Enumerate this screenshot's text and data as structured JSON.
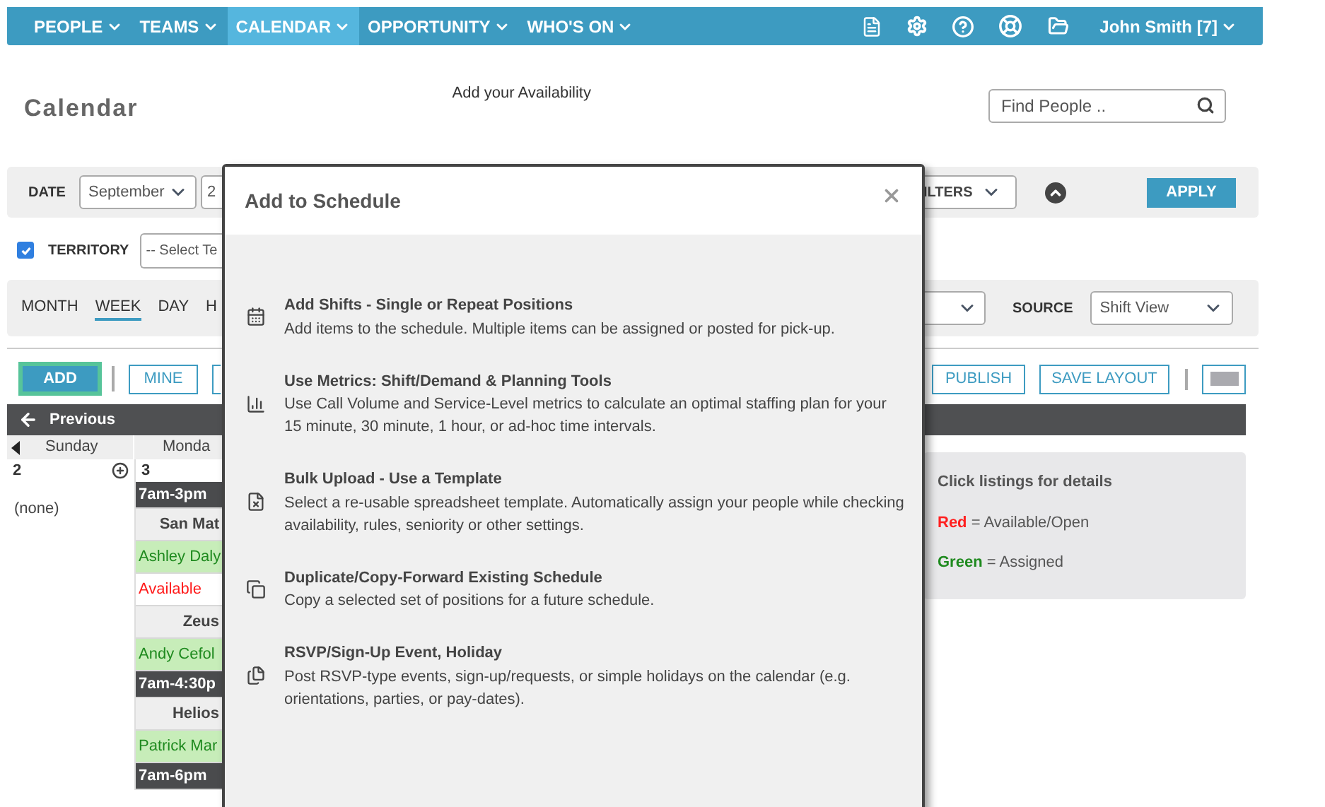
{
  "nav": {
    "items": [
      {
        "label": "PEOPLE",
        "selected": false
      },
      {
        "label": "TEAMS",
        "selected": false
      },
      {
        "label": "CALENDAR",
        "selected": true
      },
      {
        "label": "OPPORTUNITY",
        "selected": false
      },
      {
        "label": "WHO'S ON",
        "selected": false
      }
    ],
    "user": "John Smith [7]"
  },
  "page_title": "Calendar",
  "availability_link": "Add your Availability",
  "search": {
    "placeholder": "Find People .."
  },
  "filters": {
    "date_label": "DATE",
    "date_month": "September",
    "date_day": "2",
    "filters_select": "ILTERS",
    "apply": "APPLY"
  },
  "territory": {
    "checked": true,
    "label": "TERRITORY",
    "select": "-- Select Te"
  },
  "views": {
    "tabs": [
      {
        "label": "MONTH",
        "selected": false
      },
      {
        "label": "WEEK",
        "selected": true
      },
      {
        "label": "DAY",
        "selected": false
      },
      {
        "label": "H",
        "selected": false
      }
    ],
    "source_label": "SOURCE",
    "source_value": "Shift View"
  },
  "toolbar": {
    "add": "ADD",
    "mine": "MINE",
    "publish": "PUBLISH",
    "save_layout": "SAVE LAYOUT"
  },
  "calendar": {
    "previous": "Previous",
    "days": [
      {
        "name": "Sunday",
        "date": "2",
        "entries": [
          {
            "kind": "note",
            "text": "(none)"
          }
        ]
      },
      {
        "name": "Monda",
        "date": "3",
        "entries": [
          {
            "kind": "time",
            "text": "7am-3pm"
          },
          {
            "kind": "location",
            "text": "San Mat"
          },
          {
            "kind": "assigned",
            "text": "Ashley Daly"
          },
          {
            "kind": "open",
            "text": "Available"
          },
          {
            "kind": "location",
            "text": "Zeus"
          },
          {
            "kind": "assigned",
            "text": "Andy Cefol"
          },
          {
            "kind": "time",
            "text": "7am-4:30p"
          },
          {
            "kind": "location",
            "text": "Helios"
          },
          {
            "kind": "assigned",
            "text": "Patrick Mar"
          },
          {
            "kind": "time",
            "text": "7am-6pm"
          }
        ]
      }
    ]
  },
  "legend": {
    "title": "Click listings for details",
    "items": [
      {
        "label": "Red",
        "color": "#ff2020",
        "text": "= Available/Open"
      },
      {
        "label": "Green",
        "color": "#1f8a1f",
        "text": "= Assigned"
      }
    ]
  },
  "modal": {
    "title": "Add to Schedule",
    "options": [
      {
        "title": "Add Shifts - Single or Repeat Positions",
        "description": "Add items to the schedule. Multiple items can be assigned or posted for pick-up."
      },
      {
        "title": "Use Metrics: Shift/Demand & Planning Tools",
        "description": "Use Call Volume and Service-Level metrics to calculate an optimal staffing plan for your 15 minute, 30 minute, 1 hour, or ad-hoc time intervals."
      },
      {
        "title": "Bulk Upload - Use a Template",
        "description": "Select a re-usable spreadsheet template. Automatically assign your people while checking availability, rules, seniority or other settings."
      },
      {
        "title": "Duplicate/Copy-Forward Existing Schedule",
        "description": "Copy a selected set of positions for a future schedule."
      },
      {
        "title": "RSVP/Sign-Up Event, Holiday",
        "description": "Post RSVP-type events, sign-up/requests, or simple holidays on the calendar (e.g. orientations, parties, or pay-dates)."
      }
    ]
  }
}
